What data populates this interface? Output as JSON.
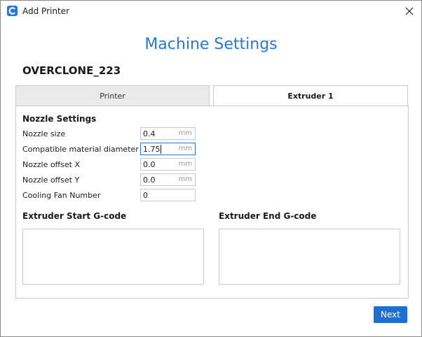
{
  "window": {
    "title": "Add Printer"
  },
  "page": {
    "heading": "Machine Settings",
    "printer_name": "OVERCLONE_223"
  },
  "tabs": [
    {
      "label": "Printer",
      "selected": false
    },
    {
      "label": "Extruder 1",
      "selected": true
    }
  ],
  "nozzle": {
    "section_title": "Nozzle Settings",
    "fields": [
      {
        "label": "Nozzle size",
        "value": "0.4",
        "unit": "mm"
      },
      {
        "label": "Compatible material diameter",
        "value": "1.75",
        "unit": "mm"
      },
      {
        "label": "Nozzle offset X",
        "value": "0.0",
        "unit": "mm"
      },
      {
        "label": "Nozzle offset Y",
        "value": "0.0",
        "unit": "mm"
      },
      {
        "label": "Cooling Fan Number",
        "value": "0",
        "unit": ""
      }
    ]
  },
  "gcode": {
    "start_title": "Extruder Start G-code",
    "start_value": "",
    "end_title": "Extruder End G-code",
    "end_value": ""
  },
  "footer": {
    "next_label": "Next"
  },
  "colors": {
    "accent": "#2a78d6",
    "button": "#1e6fd0"
  },
  "icons": {
    "app": "cura-logo-icon",
    "close": "close-icon"
  }
}
